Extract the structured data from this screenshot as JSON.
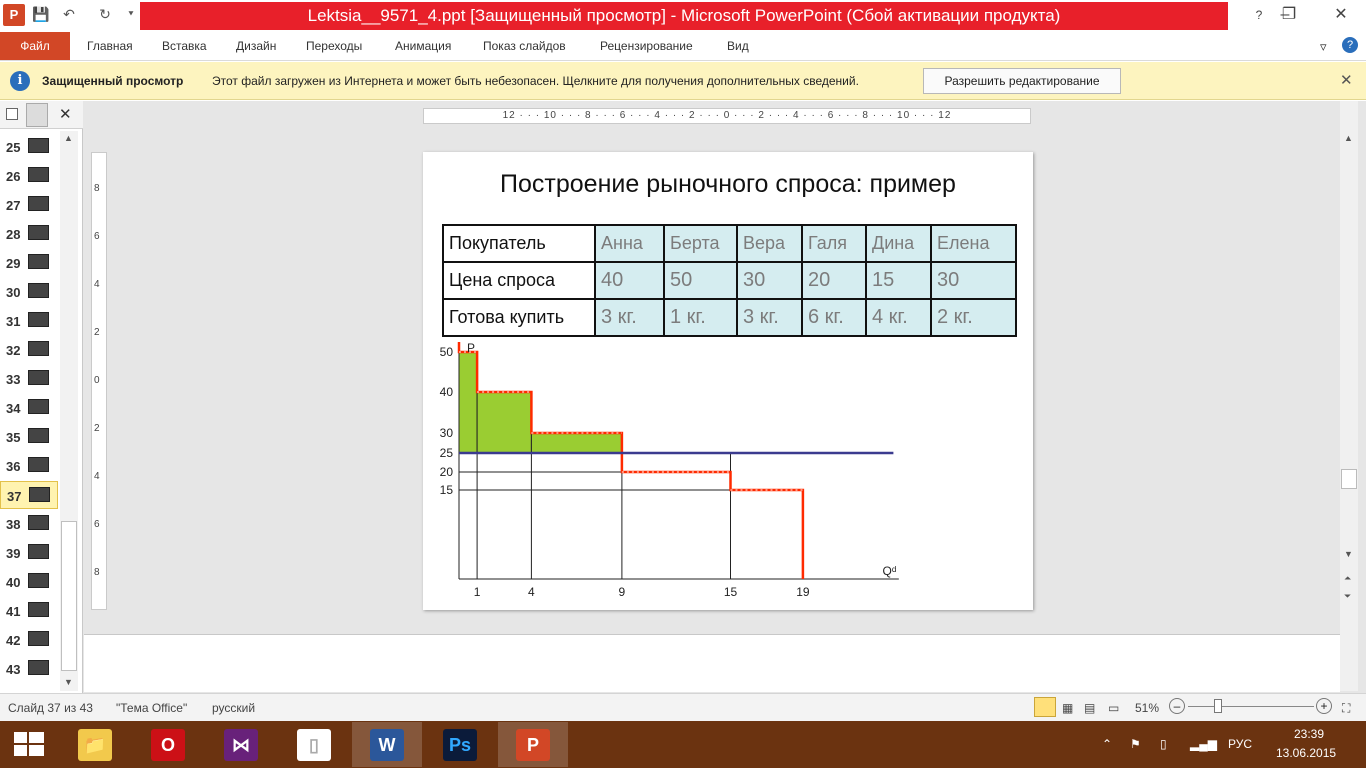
{
  "window": {
    "title": "Lektsia__9571_4.ppt [Защищенный просмотр] - Microsoft PowerPoint (Сбой активации продукта)",
    "app_letter": "P",
    "minimize": "–",
    "restore": "❐",
    "close": "✕"
  },
  "quick_access": {
    "save": "💾",
    "undo": "↶",
    "redo": "↻",
    "customize": "⯆"
  },
  "menu": {
    "file": "Файл",
    "tabs": [
      "Главная",
      "Вставка",
      "Дизайн",
      "Переходы",
      "Анимация",
      "Показ слайдов",
      "Рецензирование",
      "Вид"
    ],
    "collapse": "▿",
    "help": "?"
  },
  "protected_view": {
    "title": "Защищенный просмотр",
    "message": "Этот файл загружен из Интернета и может быть небезопасен. Щелкните для получения дополнительных сведений.",
    "button": "Разрешить редактирование",
    "close": "✕"
  },
  "slides_panel": {
    "close": "✕",
    "items": [
      {
        "num": "25"
      },
      {
        "num": "26"
      },
      {
        "num": "27"
      },
      {
        "num": "28"
      },
      {
        "num": "29"
      },
      {
        "num": "30"
      },
      {
        "num": "31"
      },
      {
        "num": "32"
      },
      {
        "num": "33"
      },
      {
        "num": "34"
      },
      {
        "num": "35"
      },
      {
        "num": "36"
      },
      {
        "num": "37"
      },
      {
        "num": "38"
      },
      {
        "num": "39"
      },
      {
        "num": "40"
      },
      {
        "num": "41"
      },
      {
        "num": "42"
      },
      {
        "num": "43"
      }
    ],
    "selected": "37"
  },
  "ruler": {
    "horizontal": "12 · · · 10 · · · 8 · · · 6 · · · 4 · · · 2 · · · 0 · · · 2 · · · 4 · · · 6 · · · 8 · · · 10 · · · 12",
    "vertical": [
      "8",
      "6",
      "4",
      "2",
      "0",
      "2",
      "4",
      "6",
      "8"
    ]
  },
  "slide": {
    "title": "Построение рыночного спроса: пример",
    "table": {
      "header": [
        "Покупатель",
        "Анна",
        "Берта",
        "Вера",
        "Галя",
        "Дина",
        "Елена"
      ],
      "price_row": [
        "Цена  спроса",
        "40",
        "50",
        "30",
        "20",
        "15",
        "30"
      ],
      "qty_row": [
        "Готова купить",
        "3 кг.",
        "1 кг.",
        "3 кг.",
        "6 кг.",
        "4 кг.",
        "2 кг."
      ]
    }
  },
  "chart_data": {
    "type": "line",
    "title": "",
    "ylabel": "P",
    "xlabel": "Qᵈ",
    "x_ticks": [
      1,
      4,
      9,
      15,
      19
    ],
    "y_ticks": [
      50,
      40,
      30,
      25,
      20,
      15
    ],
    "series": [
      {
        "style": "step",
        "color": "#ff2a00",
        "points": [
          [
            0,
            58
          ],
          [
            0,
            50
          ],
          [
            1,
            50
          ],
          [
            1,
            40
          ],
          [
            4,
            40
          ],
          [
            4,
            30
          ],
          [
            9,
            30
          ],
          [
            9,
            20
          ],
          [
            15,
            20
          ],
          [
            15,
            15
          ],
          [
            19,
            15
          ],
          [
            19,
            0
          ]
        ]
      },
      {
        "style": "horizontal",
        "color": "#3b3b8f",
        "points": [
          [
            0,
            25
          ],
          [
            24,
            25
          ]
        ]
      }
    ],
    "surplus_fill": {
      "color": "#9acd32",
      "steps": [
        [
          0,
          1,
          50
        ],
        [
          1,
          4,
          40
        ],
        [
          4,
          9,
          30
        ]
      ],
      "price": 25
    },
    "xlim": [
      0,
      24
    ],
    "ylim": [
      0,
      60
    ]
  },
  "status": {
    "slide": "Слайд 37 из 43",
    "theme": "\"Тема Office\"",
    "language": "русский",
    "zoom": "51%",
    "zoom_minus": "–",
    "zoom_plus": "+"
  },
  "taskbar": {
    "apps": [
      {
        "icon": "file-explorer-icon",
        "glyph": "📁"
      },
      {
        "icon": "opera-icon",
        "glyph": "O"
      },
      {
        "icon": "visual-studio-icon",
        "glyph": "⋈"
      },
      {
        "icon": "blank-document-icon",
        "glyph": "▯"
      },
      {
        "icon": "word-icon",
        "glyph": "W"
      },
      {
        "icon": "photoshop-icon",
        "glyph": "Ps"
      },
      {
        "icon": "powerpoint-icon",
        "glyph": "P"
      }
    ],
    "lang": "РУС",
    "time": "23:39",
    "date": "13.06.2015"
  },
  "colors": {
    "accent": "#d24726",
    "title_bar": "#e8202a",
    "protected_bar": "#fdf4bf",
    "table_fill": "#d5edf0"
  }
}
